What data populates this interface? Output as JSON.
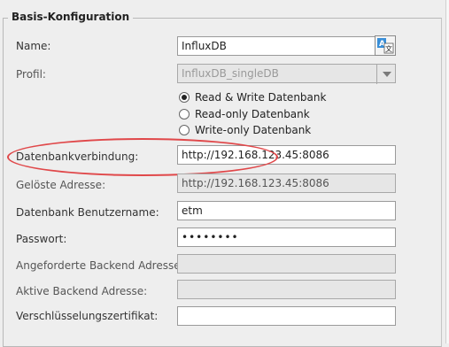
{
  "section": {
    "title": "Basis-Konfiguration"
  },
  "name": {
    "label": "Name:",
    "value": "InfluxDB"
  },
  "profil": {
    "label": "Profil:",
    "value": "InfluxDB_singleDB"
  },
  "access_mode": {
    "options": [
      {
        "label": "Read & Write Datenbank",
        "checked": true
      },
      {
        "label": "Read-only Datenbank",
        "checked": false
      },
      {
        "label": "Write-only Datenbank",
        "checked": false
      }
    ]
  },
  "connection": {
    "label": "Datenbankverbindung:",
    "value": "http://192.168.123.45:8086"
  },
  "resolved": {
    "label": "Gelöste Adresse:",
    "value": "http://192.168.123.45:8086"
  },
  "username": {
    "label": "Datenbank Benutzername:",
    "value": "etm"
  },
  "password": {
    "label": "Passwort:",
    "value": "••••••••"
  },
  "requested_backend": {
    "label": "Angeforderte Backend Adresse:",
    "value": ""
  },
  "active_backend": {
    "label": "Aktive Backend Adresse:",
    "value": ""
  },
  "certificate": {
    "label": "Verschlüsselungszertifikat:",
    "value": ""
  },
  "colors": {
    "highlight": "#e0484a",
    "translate_icon": "#3a8fd8"
  },
  "icons": {
    "translate": "translate-icon",
    "dropdown": "chevron-down-icon"
  }
}
